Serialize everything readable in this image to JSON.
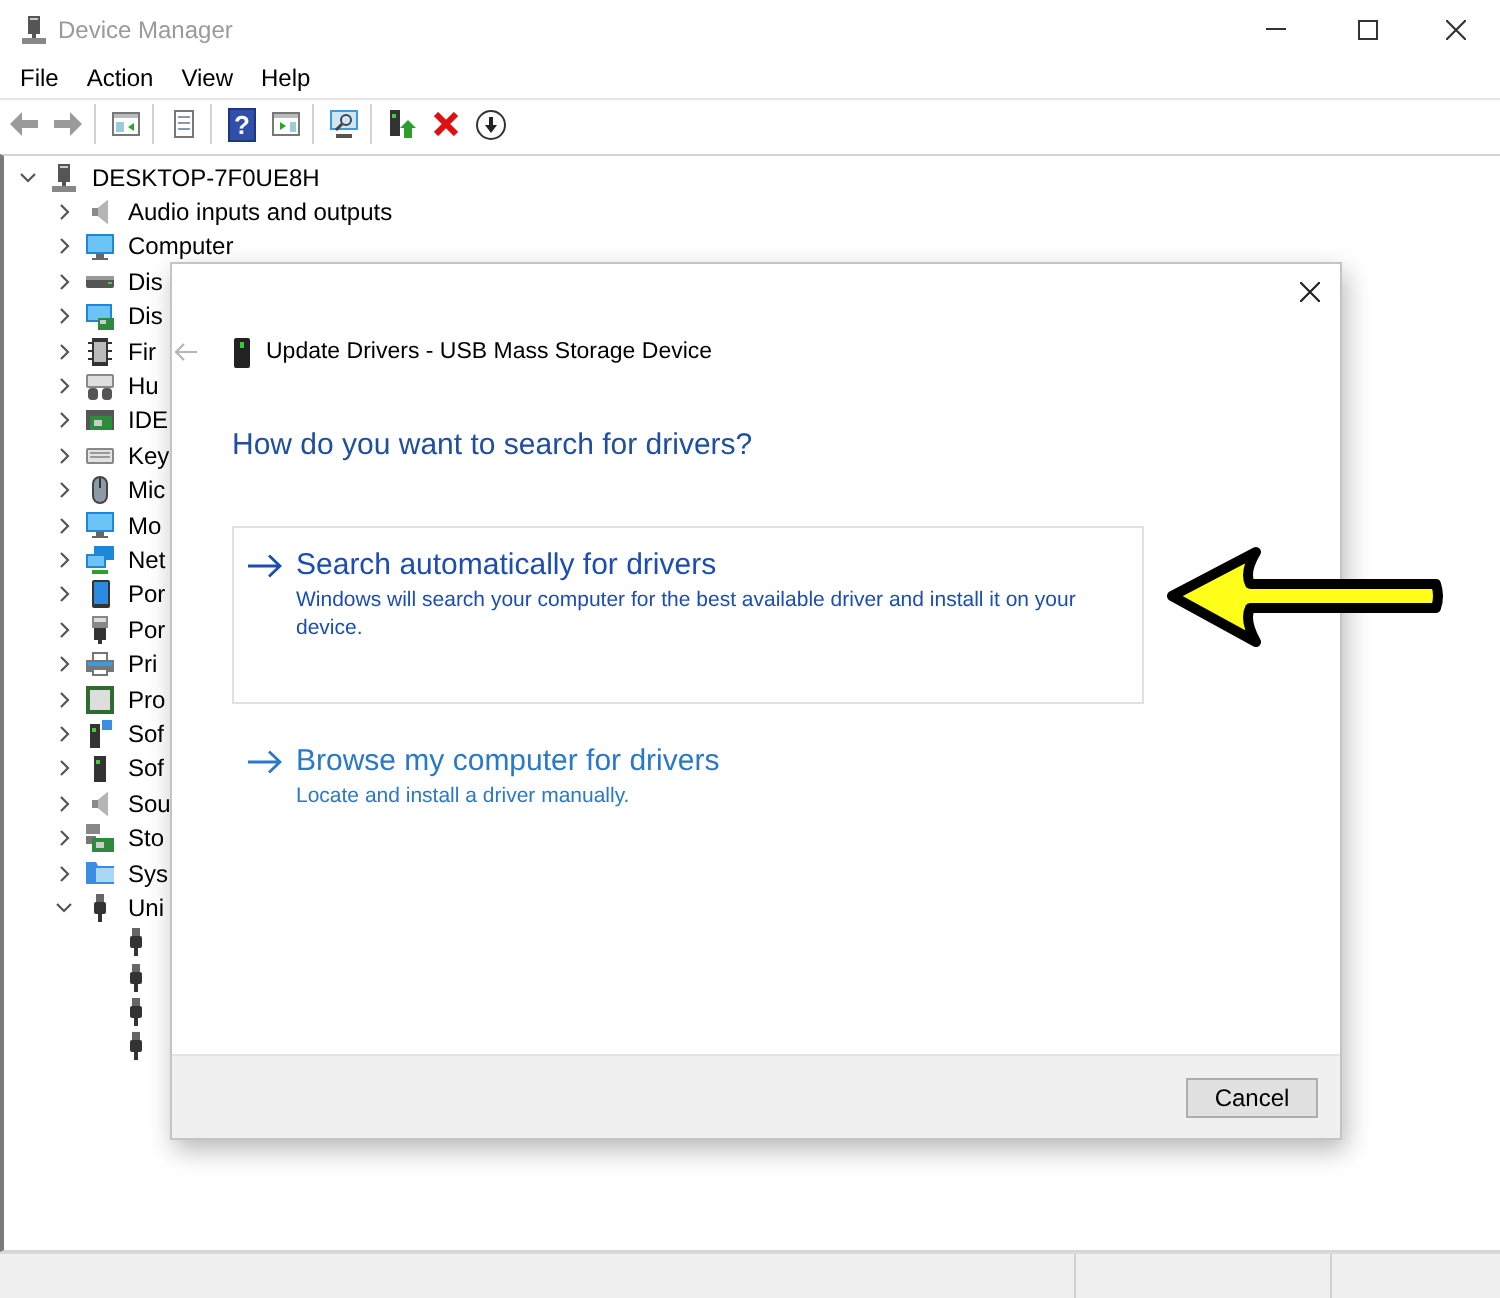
{
  "window": {
    "title": "Device Manager"
  },
  "menu": [
    "File",
    "Action",
    "View",
    "Help"
  ],
  "toolbar": [
    {
      "kind": "back"
    },
    {
      "kind": "forward"
    },
    {
      "kind": "separator"
    },
    {
      "kind": "properties"
    },
    {
      "kind": "separator"
    },
    {
      "kind": "list"
    },
    {
      "kind": "separator"
    },
    {
      "kind": "help",
      "glyph": "?"
    },
    {
      "kind": "panel"
    },
    {
      "kind": "separator"
    },
    {
      "kind": "scan"
    },
    {
      "kind": "separator"
    },
    {
      "kind": "update"
    },
    {
      "kind": "uninstall"
    },
    {
      "kind": "disable"
    }
  ],
  "tree": {
    "label": "DESKTOP-7F0UE8H",
    "kind": "root",
    "expanded": true,
    "children": [
      {
        "label": "Audio inputs and outputs",
        "kind": "audio",
        "expanded": false
      },
      {
        "label": "Computer",
        "kind": "computer",
        "expanded": false
      },
      {
        "label": "Dis",
        "kind": "disk",
        "expanded": false
      },
      {
        "label": "Dis",
        "kind": "display",
        "expanded": false
      },
      {
        "label": "Fir",
        "kind": "firmware",
        "expanded": false
      },
      {
        "label": "Hu",
        "kind": "hid",
        "expanded": false
      },
      {
        "label": "IDE",
        "kind": "ide",
        "expanded": false
      },
      {
        "label": "Key",
        "kind": "keyboard",
        "expanded": false
      },
      {
        "label": "Mic",
        "kind": "mouse",
        "expanded": false
      },
      {
        "label": "Mo",
        "kind": "monitor",
        "expanded": false
      },
      {
        "label": "Net",
        "kind": "network",
        "expanded": false
      },
      {
        "label": "Por",
        "kind": "portable",
        "expanded": false
      },
      {
        "label": "Por",
        "kind": "port",
        "expanded": false
      },
      {
        "label": "Pri",
        "kind": "printer",
        "expanded": false
      },
      {
        "label": "Pro",
        "kind": "processor",
        "expanded": false
      },
      {
        "label": "Sof",
        "kind": "component",
        "expanded": false
      },
      {
        "label": "Sof",
        "kind": "software",
        "expanded": false
      },
      {
        "label": "Sou",
        "kind": "sound",
        "expanded": false
      },
      {
        "label": "Sto",
        "kind": "storage",
        "expanded": false
      },
      {
        "label": "Sys",
        "kind": "system",
        "expanded": false
      },
      {
        "label": "Uni",
        "kind": "usb",
        "expanded": true,
        "children": [
          {
            "kind": "usb"
          },
          {
            "kind": "usb"
          },
          {
            "kind": "usb"
          },
          {
            "kind": "usb"
          }
        ]
      }
    ]
  },
  "dialog": {
    "title": "Update Drivers - USB Mass Storage Device",
    "heading": "How do you want to search for drivers?",
    "options": [
      {
        "title": "Search automatically for drivers",
        "description": "Windows will search your computer for the best available driver and install it on your device.",
        "selected": true
      },
      {
        "title": "Browse my computer for drivers",
        "description": "Locate and install a driver manually.",
        "selected": false
      }
    ],
    "buttons": [
      "Cancel"
    ]
  }
}
